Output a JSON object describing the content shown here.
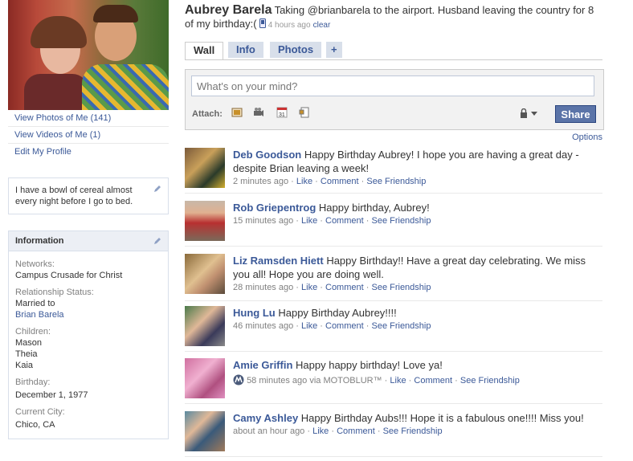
{
  "left": {
    "links": [
      "View Photos of Me (141)",
      "View Videos of Me (1)",
      "Edit My Profile"
    ],
    "bio": "I have a bowl of cereal almost every night before I go to bed.",
    "info": {
      "title": "Information",
      "networks_label": "Networks:",
      "networks_value": "Campus Crusade for Christ",
      "relationship_label": "Relationship Status:",
      "relationship_value": "Married to",
      "relationship_link": "Brian Barela",
      "children_label": "Children:",
      "children": [
        "Mason",
        "Theia",
        "Kaia"
      ],
      "birthday_label": "Birthday:",
      "birthday_value": "December 1, 1977",
      "city_label": "Current City:",
      "city_value": "Chico, CA"
    }
  },
  "header": {
    "name": "Aubrey Barela",
    "status": "Taking @brianbarela to the airport. Husband leaving the country for 8",
    "status_cont": "of my birthday:(",
    "time": "4 hours ago",
    "clear": "clear"
  },
  "tabs": [
    "Wall",
    "Info",
    "Photos",
    "+"
  ],
  "composer": {
    "placeholder": "What's on your mind?",
    "attach_label": "Attach:",
    "share": "Share"
  },
  "options": "Options",
  "feed": [
    {
      "author": "Deb Goodson",
      "text": "Happy Birthday Aubrey! I hope you are having a great day - despite Brian leaving a week!",
      "time": "2 minutes ago",
      "via": "",
      "like": "Like",
      "comment": "Comment",
      "friendship": "See Friendship"
    },
    {
      "author": "Rob Griepentrog",
      "text": "Happy birthday, Aubrey!",
      "time": "15 minutes ago",
      "via": "",
      "like": "Like",
      "comment": "Comment",
      "friendship": "See Friendship"
    },
    {
      "author": "Liz Ramsden Hiett",
      "text": "Happy Birthday!! Have a great day celebrating. We miss you all! Hope you are doing well.",
      "time": "28 minutes ago",
      "via": "",
      "like": "Like",
      "comment": "Comment",
      "friendship": "See Friendship"
    },
    {
      "author": "Hung Lu",
      "text": "Happy Birthday Aubrey!!!!",
      "time": "46 minutes ago",
      "via": "",
      "like": "Like",
      "comment": "Comment",
      "friendship": "See Friendship"
    },
    {
      "author": "Amie Griffin",
      "text": "Happy happy birthday! Love ya!",
      "time": "58 minutes ago",
      "via": "via MOTOBLUR™",
      "like": "Like",
      "comment": "Comment",
      "friendship": "See Friendship"
    },
    {
      "author": "Camy Ashley",
      "text": "Happy Birthday Aubs!!! Hope it is a fabulous one!!!! Miss you!",
      "time": "about an hour ago",
      "via": "",
      "like": "Like",
      "comment": "Comment",
      "friendship": "See Friendship"
    }
  ]
}
